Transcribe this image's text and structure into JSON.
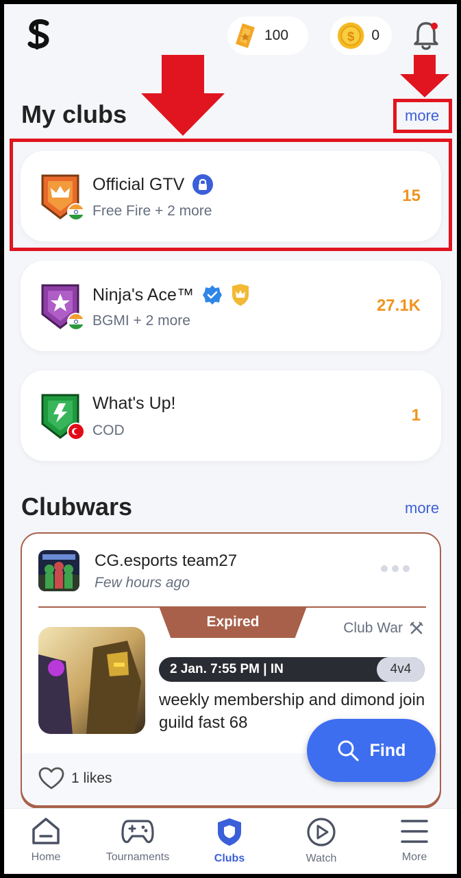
{
  "header": {
    "logo_icon": "gtv-logo-icon",
    "tickets_count": "100",
    "coins_count": "0",
    "bell_icon": "bell-icon"
  },
  "my_clubs": {
    "title": "My clubs",
    "more_label": "more",
    "clubs": [
      {
        "name": "Official GTV",
        "badge": "lock-icon",
        "sub": "Free Fire + 2 more",
        "count": "15",
        "shield_color": "#e8692a",
        "flag": "India"
      },
      {
        "name": "Ninja's Ace™",
        "badge": "verified-icon",
        "sub": "BGMI + 2 more",
        "count": "27.1K",
        "shield_color": "#8e3fa6",
        "flag": "India"
      },
      {
        "name": "What's Up!",
        "badge": "",
        "sub": "COD",
        "count": "1",
        "shield_color": "#1e9a3d",
        "flag": "Turkey"
      }
    ]
  },
  "clubwars": {
    "title": "Clubwars",
    "more_label": "more",
    "card": {
      "team_name": "CG.esports team27",
      "time": "Few hours ago",
      "status": "Expired",
      "type": "Club War",
      "date": "2 Jan. 7:55 PM | IN",
      "mode": "4v4",
      "title": "weekly membership and dimond join guild fast 68",
      "likes": "1 likes"
    }
  },
  "find_button": {
    "label": "Find"
  },
  "nav": {
    "items": [
      {
        "label": "Home"
      },
      {
        "label": "Tournaments"
      },
      {
        "label": "Clubs"
      },
      {
        "label": "Watch"
      },
      {
        "label": "More"
      }
    ],
    "active": "Clubs"
  },
  "colors": {
    "accent": "#3b5fd9",
    "count": "#f0931e",
    "highlight": "#e0151f",
    "expired": "#a8604a"
  }
}
